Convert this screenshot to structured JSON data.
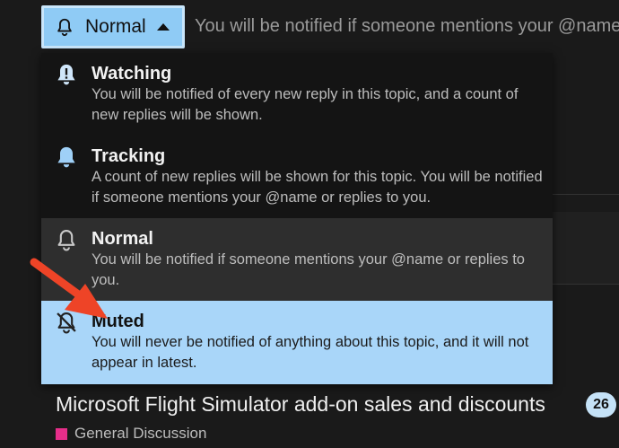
{
  "notification_button": {
    "label": "Normal",
    "icon": "bell-icon"
  },
  "status_text": "You will be notified if someone mentions your @name or replies to you.",
  "menu": {
    "items": [
      {
        "name": "Watching",
        "description": "You will be notified of every new reply in this topic, and a count of new replies will be shown.",
        "icon": "bell-exclamation-icon"
      },
      {
        "name": "Tracking",
        "description": "A count of new replies will be shown for this topic. You will be notified if someone mentions your @name or replies to you.",
        "icon": "bell-icon"
      },
      {
        "name": "Normal",
        "description": "You will be notified if someone mentions your @name or replies to you.",
        "icon": "bell-outline-icon"
      },
      {
        "name": "Muted",
        "description": "You will never be notified of anything about this topic, and it will not appear in latest.",
        "icon": "bell-slash-icon"
      }
    ]
  },
  "topic": {
    "title": "Microsoft Flight Simulator add-on sales and discounts",
    "reply_count": "26",
    "category": "General Discussion",
    "category_color": "#e62e8a"
  },
  "colors": {
    "button_bg": "#8fcbf5",
    "muted_highlight": "#a9d6f9",
    "annotation_arrow": "#ee4427"
  }
}
